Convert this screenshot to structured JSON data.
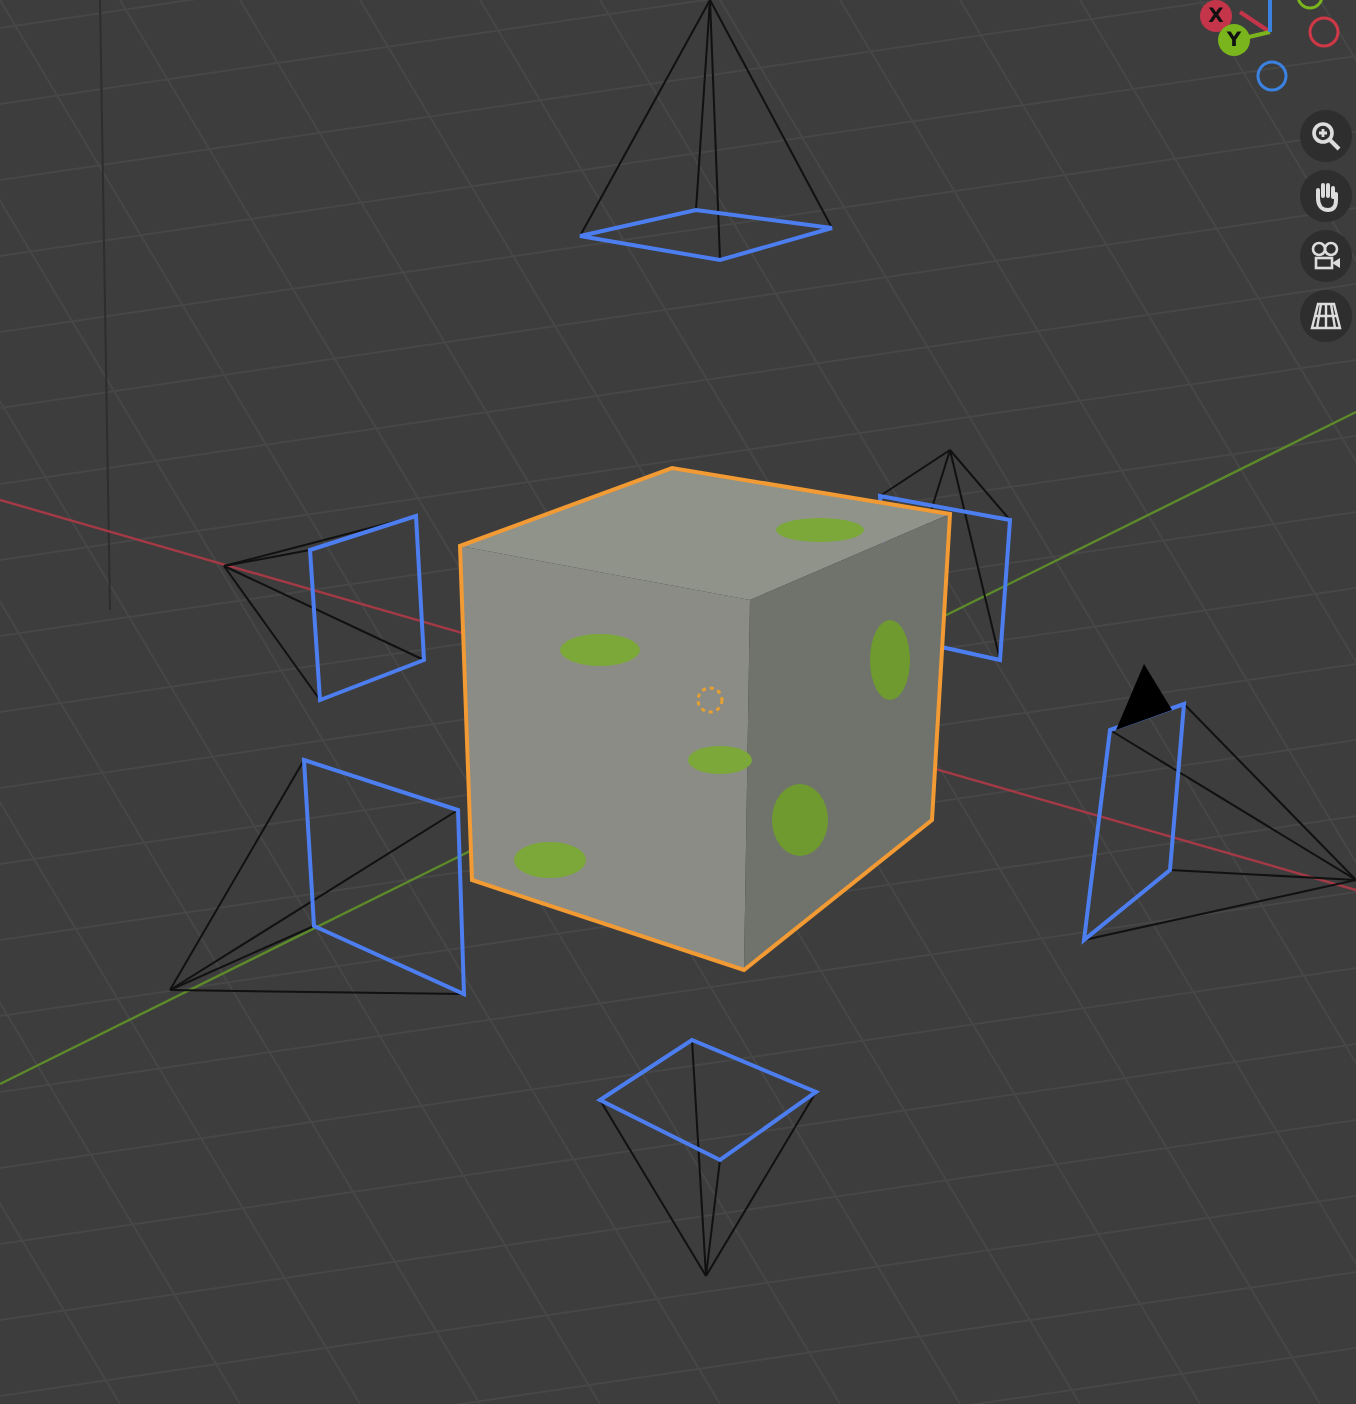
{
  "gizmo": {
    "axes": [
      {
        "label": "X",
        "color": "#c4354a"
      },
      {
        "label": "Y",
        "color": "#7ab51d"
      }
    ]
  },
  "nav_buttons": [
    {
      "kind": "zoom"
    },
    {
      "kind": "pan"
    },
    {
      "kind": "camera"
    },
    {
      "kind": "grid"
    }
  ]
}
